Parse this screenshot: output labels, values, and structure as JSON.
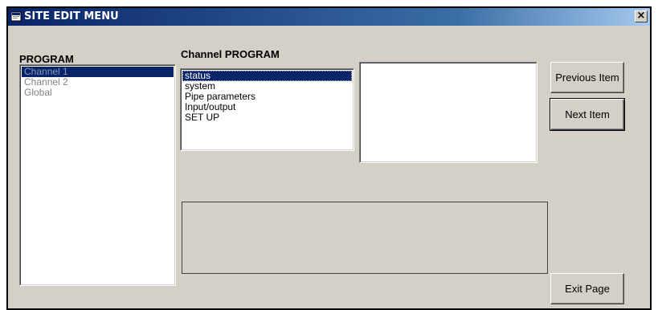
{
  "window": {
    "title": "SITE EDIT MENU",
    "close_label": "×"
  },
  "program": {
    "heading": "PROGRAM",
    "items": [
      "Channel 1",
      "Channel 2",
      "Global"
    ],
    "selected": "Channel 1"
  },
  "channel_program": {
    "heading": "Channel PROGRAM",
    "items": [
      "status",
      "system",
      "Pipe parameters",
      "Input/output",
      "SET UP"
    ],
    "selected": "status"
  },
  "buttons": {
    "previous": "Previous Item",
    "next": "Next Item",
    "exit": "Exit Page"
  },
  "icons": {
    "title": "window-app-icon",
    "close": "close-icon"
  }
}
